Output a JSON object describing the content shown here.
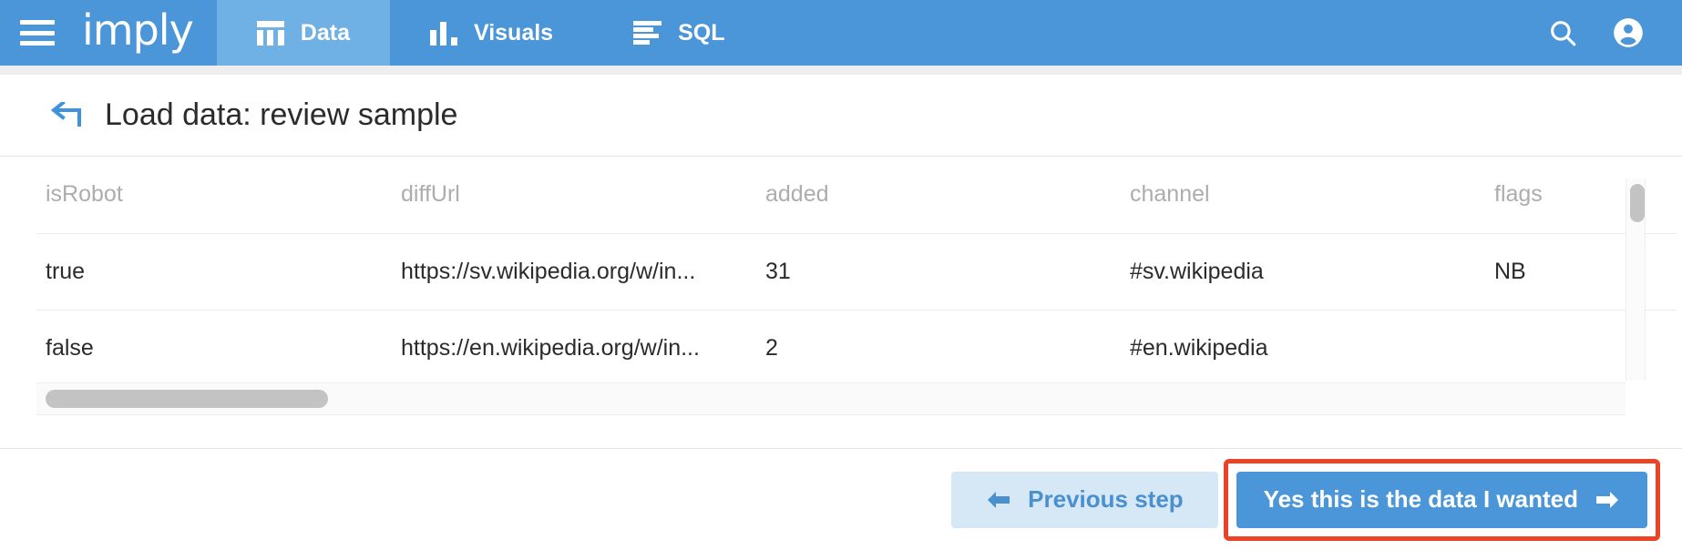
{
  "app": {
    "logo_text": "imply",
    "brand_color": "#4a96d9",
    "active_tab_color": "#6fb0e5",
    "highlight_color": "#ec4226"
  },
  "topnav": {
    "menu_icon": "hamburger-menu-icon",
    "tabs": [
      {
        "label": "Data",
        "icon": "table-columns-icon",
        "active": true
      },
      {
        "label": "Visuals",
        "icon": "bar-chart-icon",
        "active": false
      },
      {
        "label": "SQL",
        "icon": "text-lines-icon",
        "active": false
      }
    ],
    "right_icons": [
      {
        "name": "search-icon"
      },
      {
        "name": "account-circle-icon"
      }
    ]
  },
  "page": {
    "back_icon": "back-arrow-icon",
    "title": "Load data: review sample"
  },
  "table": {
    "columns": [
      "isRobot",
      "diffUrl",
      "added",
      "channel",
      "flags"
    ],
    "rows": [
      {
        "isRobot": "true",
        "diffUrl": "https://sv.wikipedia.org/w/in...",
        "added": "31",
        "channel": "#sv.wikipedia",
        "flags": "NB"
      },
      {
        "isRobot": "false",
        "diffUrl": "https://en.wikipedia.org/w/in...",
        "added": "2",
        "channel": "#en.wikipedia",
        "flags": ""
      }
    ]
  },
  "footer": {
    "previous_label": "Previous step",
    "previous_icon": "arrow-left-icon",
    "next_label": "Yes this is the data I wanted",
    "next_icon": "arrow-right-icon"
  }
}
